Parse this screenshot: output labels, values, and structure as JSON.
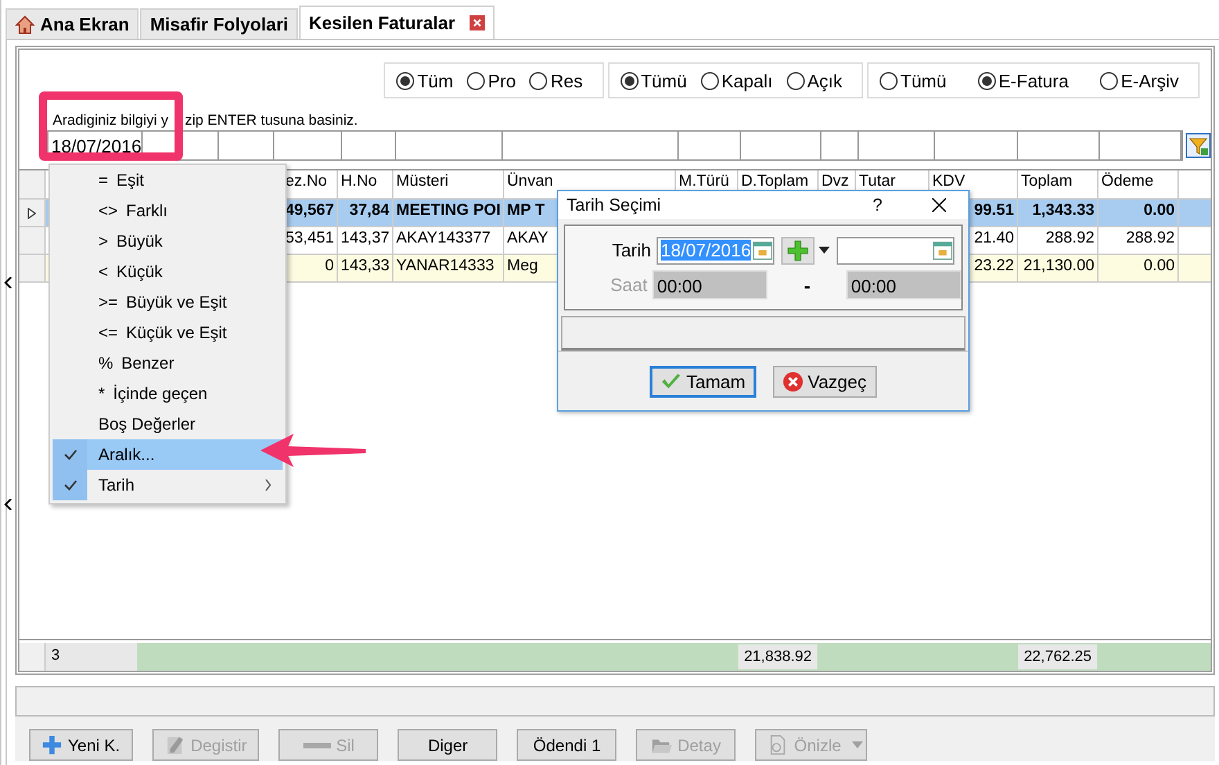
{
  "tabs": [
    {
      "label": "Ana Ekran",
      "selected": false
    },
    {
      "label": "Misafir Folyolari",
      "selected": false
    },
    {
      "label": "Kesilen Faturalar",
      "selected": true
    }
  ],
  "radio_groups": [
    [
      {
        "label": "Tüm",
        "selected": true
      },
      {
        "label": "Pro",
        "selected": false
      },
      {
        "label": "Res",
        "selected": false
      }
    ],
    [
      {
        "label": "Tümü",
        "selected": true
      },
      {
        "label": "Kapalı",
        "selected": false
      },
      {
        "label": "Açık",
        "selected": false
      }
    ],
    [
      {
        "label": "Tümü",
        "selected": false
      },
      {
        "label": "E-Fatura",
        "selected": true
      },
      {
        "label": "E-Arşiv",
        "selected": false
      }
    ]
  ],
  "hint": [
    "Aradiginiz bilgiyi y",
    "zip ENTER tusuna basiniz."
  ],
  "filter": {
    "value": "18/07/2016"
  },
  "table": {
    "columns": [
      "ez.No",
      "H.No",
      "Müsteri",
      "Ünvan",
      "M.Türü",
      "D.Toplam",
      "Dvz",
      "Tutar",
      "KDV",
      "Toplam",
      "Ödeme"
    ],
    "rows": [
      {
        "selected": true,
        "highlighted": false,
        "cells": [
          "49,567",
          "37,84",
          "MEETING POI",
          "MP T",
          null,
          null,
          null,
          null,
          "99.51",
          "1,343.33",
          "0.00"
        ]
      },
      {
        "selected": false,
        "highlighted": false,
        "cells": [
          "53,451",
          "143,37",
          "AKAY143377",
          "AKAY",
          null,
          null,
          null,
          null,
          "21.40",
          "288.92",
          "288.92"
        ]
      },
      {
        "selected": false,
        "highlighted": true,
        "cells": [
          "0",
          "143,33",
          "YANAR14333",
          "Meg",
          null,
          null,
          null,
          null,
          "23.22",
          "21,130.00",
          "0.00"
        ]
      }
    ],
    "footer": {
      "count": "3",
      "cells": [
        null,
        null,
        null,
        null,
        null,
        "21,838.92",
        null,
        null,
        null,
        "22,762.25",
        null
      ]
    }
  },
  "buttons": [
    {
      "label": "Yeni K.",
      "disabled": false,
      "dropdown": false
    },
    {
      "label": "Degistir",
      "disabled": true,
      "dropdown": false
    },
    {
      "label": "Sil",
      "disabled": true,
      "dropdown": false
    },
    {
      "label": "Diger",
      "disabled": false,
      "dropdown": false
    },
    {
      "label": "Ödendi 1",
      "disabled": false,
      "dropdown": false
    },
    {
      "label": "Detay",
      "disabled": true,
      "dropdown": false
    },
    {
      "label": "Önizle",
      "disabled": true,
      "dropdown": true
    }
  ],
  "menu": [
    {
      "symbol": "=",
      "label": "Eşit",
      "checked": false,
      "selected": false,
      "submenu": false
    },
    {
      "symbol": "<>",
      "label": "Farklı",
      "checked": false,
      "selected": false,
      "submenu": false
    },
    {
      "symbol": ">",
      "label": "Büyük",
      "checked": false,
      "selected": false,
      "submenu": false
    },
    {
      "symbol": "<",
      "label": "Küçük",
      "checked": false,
      "selected": false,
      "submenu": false
    },
    {
      "symbol": ">=",
      "label": "Büyük ve Eşit",
      "checked": false,
      "selected": false,
      "submenu": false
    },
    {
      "symbol": "<=",
      "label": "Küçük ve Eşit",
      "checked": false,
      "selected": false,
      "submenu": false
    },
    {
      "symbol": "%",
      "label": "Benzer",
      "checked": false,
      "selected": false,
      "submenu": false
    },
    {
      "symbol": "*",
      "label": "İçinde geçen",
      "checked": false,
      "selected": false,
      "submenu": false
    },
    {
      "label": "Boş Değerler",
      "checked": false,
      "selected": false,
      "submenu": false
    },
    {
      "label": "Aralık...",
      "checked": true,
      "selected": true,
      "submenu": false
    },
    {
      "label": "Tarih",
      "checked": true,
      "selected": false,
      "submenu": true
    }
  ],
  "dialog": {
    "title": "Tarih Seçimi",
    "help": "?",
    "date_label": "Tarih",
    "date_from": "18/07/2016",
    "time_label": "Saat",
    "time_disabled": true,
    "time_from": "00:00",
    "separator": "-",
    "time_to": "00:00",
    "ok": "Tamam",
    "cancel": "Vazgeç"
  }
}
